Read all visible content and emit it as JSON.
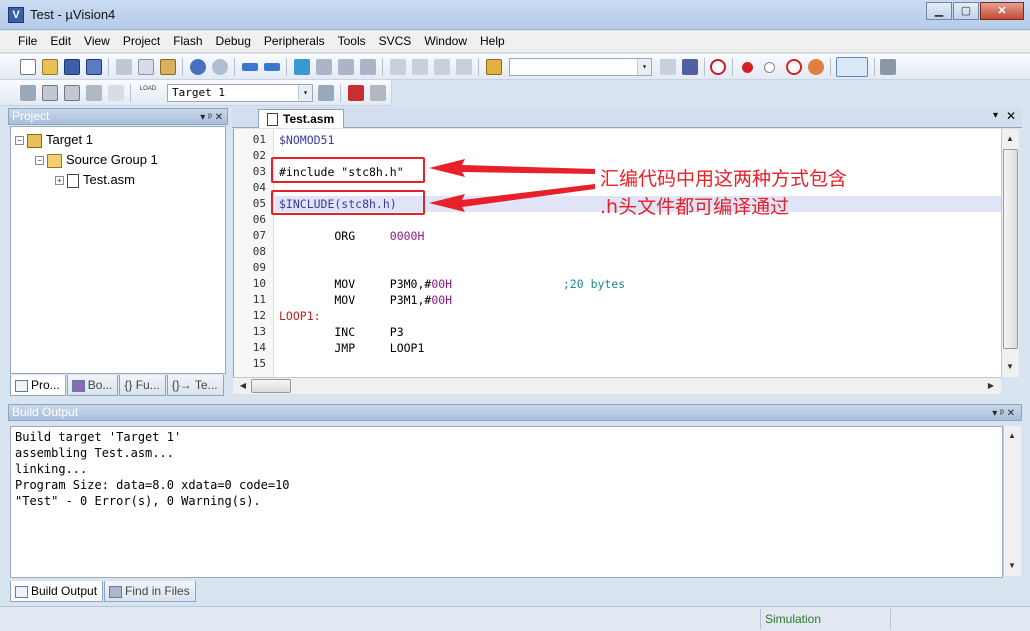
{
  "window": {
    "title": "Test  - µVision4",
    "app_icon": "V",
    "min": "▁",
    "max": "▢",
    "close": "✕"
  },
  "menu": [
    "File",
    "Edit",
    "View",
    "Project",
    "Flash",
    "Debug",
    "Peripherals",
    "Tools",
    "SVCS",
    "Window",
    "Help"
  ],
  "toolbar": {
    "target_select": "Target 1",
    "dropdown_arrow": "▾",
    "load_label": "LOAD"
  },
  "project_panel": {
    "title": "Project",
    "pin": "▾  ᵖ  ✕",
    "tree": [
      {
        "label": "Target 1",
        "expander": "−"
      },
      {
        "label": "Source Group 1",
        "expander": "−"
      },
      {
        "label": "Test.asm",
        "expander": "+"
      }
    ],
    "tabs": [
      "Pro...",
      "Bo...",
      "{} Fu...",
      "{}→ Te..."
    ]
  },
  "editor": {
    "tab": "Test.asm",
    "close": "✕",
    "collapse": "▾",
    "lines": [
      {
        "n": "01",
        "parts": [
          {
            "t": "$NOMOD51",
            "c": "#3b3b9a"
          }
        ]
      },
      {
        "n": "02",
        "parts": []
      },
      {
        "n": "03",
        "parts": [
          {
            "t": "#include \"stc8h.h\"",
            "c": "#000000"
          }
        ]
      },
      {
        "n": "04",
        "parts": []
      },
      {
        "n": "05",
        "parts": [
          {
            "t": "$INCLUDE(stc8h.h)",
            "c": "#3b3b9a"
          }
        ]
      },
      {
        "n": "06",
        "parts": []
      },
      {
        "n": "07",
        "parts": [
          {
            "t": "        ORG     ",
            "c": "#000000"
          },
          {
            "t": "0000H",
            "c": "#8b1a8b"
          }
        ]
      },
      {
        "n": "08",
        "parts": []
      },
      {
        "n": "09",
        "parts": []
      },
      {
        "n": "10",
        "parts": [
          {
            "t": "        MOV     ",
            "c": "#000000"
          },
          {
            "t": "P3M0,#",
            "c": "#000000"
          },
          {
            "t": "00H",
            "c": "#8b1a8b"
          },
          {
            "t": "                ;20 bytes",
            "c": "#1f8a8a"
          }
        ]
      },
      {
        "n": "11",
        "parts": [
          {
            "t": "        MOV     ",
            "c": "#000000"
          },
          {
            "t": "P3M1,#",
            "c": "#000000"
          },
          {
            "t": "00H",
            "c": "#8b1a8b"
          }
        ]
      },
      {
        "n": "12",
        "parts": [
          {
            "t": "LOOP1:",
            "c": "#c0201f"
          }
        ]
      },
      {
        "n": "13",
        "parts": [
          {
            "t": "        INC     P3",
            "c": "#000000"
          }
        ]
      },
      {
        "n": "14",
        "parts": [
          {
            "t": "        JMP     LOOP1",
            "c": "#000000"
          }
        ]
      },
      {
        "n": "15",
        "parts": []
      }
    ]
  },
  "annotation": {
    "line1": "汇编代码中用这两种方式包含",
    "line2": ".h头文件都可编译通过",
    "color": "#e8202a"
  },
  "build_output": {
    "title": "Build Output",
    "pin": "▾  ᵖ  ✕",
    "lines": [
      "Build target 'Target 1'",
      "assembling Test.asm...",
      "linking...",
      "Program Size: data=8.0 xdata=0 code=10",
      "\"Test\" - 0 Error(s), 0 Warning(s)."
    ],
    "tabs": [
      "Build Output",
      "Find in Files"
    ]
  },
  "status": {
    "mode": "Simulation"
  }
}
